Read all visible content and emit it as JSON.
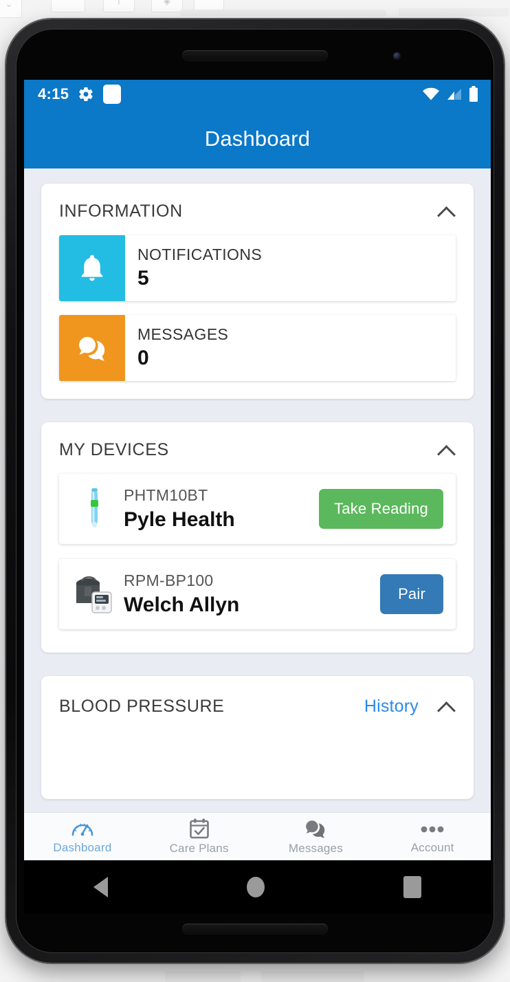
{
  "status_bar": {
    "time": "4:15",
    "icons_left": [
      "gear-icon",
      "notification-square-icon"
    ],
    "icons_right": [
      "wifi-icon",
      "cellular-signal-icon",
      "battery-icon"
    ]
  },
  "app_bar": {
    "title": "Dashboard"
  },
  "cards": {
    "information": {
      "title": "INFORMATION",
      "collapse_icon": "chevron-up-icon",
      "rows": [
        {
          "label": "NOTIFICATIONS",
          "value": "5",
          "icon": "bell-icon",
          "color": "#23bde4"
        },
        {
          "label": "MESSAGES",
          "value": "0",
          "icon": "chat-bubbles-icon",
          "color": "#f0961e"
        }
      ]
    },
    "my_devices": {
      "title": "MY DEVICES",
      "collapse_icon": "chevron-up-icon",
      "devices": [
        {
          "model": "PHTM10BT",
          "name": "Pyle Health",
          "icon": "thermometer-icon",
          "button_label": "Take Reading",
          "button_color": "#5cb85c"
        },
        {
          "model": "RPM-BP100",
          "name": "Welch Allyn",
          "icon": "blood-pressure-cuff-icon",
          "button_label": "Pair",
          "button_color": "#337ab7"
        }
      ]
    },
    "blood_pressure": {
      "title": "BLOOD PRESSURE",
      "history_label": "History",
      "history_color": "#2a8af0",
      "collapse_icon": "chevron-up-icon"
    }
  },
  "bottom_nav": {
    "items": [
      {
        "label": "Dashboard",
        "icon": "speedometer-icon",
        "active": true
      },
      {
        "label": "Care Plans",
        "icon": "calendar-check-icon",
        "active": false
      },
      {
        "label": "Messages",
        "icon": "chat-bubbles-icon",
        "active": false
      },
      {
        "label": "Account",
        "icon": "ellipsis-icon",
        "active": false
      }
    ],
    "active_color": "#6aa9e0",
    "inactive_color": "#9aa0a6"
  },
  "system_nav": {
    "back": "back-triangle-icon",
    "home": "home-circle-icon",
    "recents": "recents-square-icon"
  },
  "theme": {
    "header_blue": "#0b78c8",
    "page_background": "#e9ecf2",
    "card_background": "#ffffff"
  }
}
